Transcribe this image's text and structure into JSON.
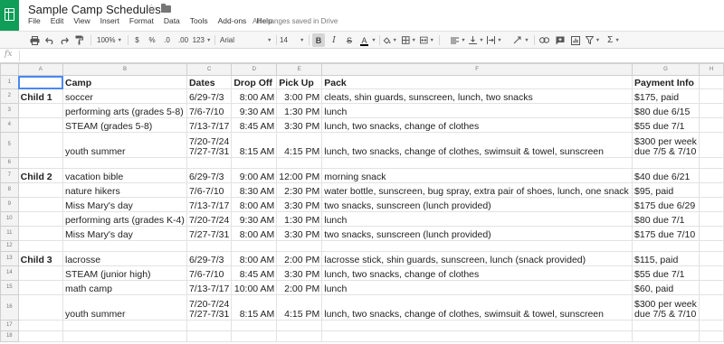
{
  "app": {
    "title": "Sample Camp Schedules",
    "save_status": "All changes saved in Drive",
    "icons": {
      "logo": "sheets-logo-icon",
      "star": "star-icon",
      "folder": "folder-icon"
    }
  },
  "menu": [
    "File",
    "Edit",
    "View",
    "Insert",
    "Format",
    "Data",
    "Tools",
    "Add-ons",
    "Help"
  ],
  "toolbar": {
    "zoom": "100%",
    "currency": "$",
    "percent": "%",
    "decrease_decimals": ".0",
    "increase_decimals": ".00",
    "more_formats": "123",
    "font": "Arial",
    "font_size": "14",
    "bold": "B",
    "italic": "I",
    "strikethrough": "S",
    "text_color": "A",
    "sum": "Σ",
    "icons": [
      "print-icon",
      "undo-icon",
      "redo-icon",
      "paint-format-icon",
      "fill-color-icon",
      "borders-icon",
      "merge-cells-icon",
      "horizontal-align-icon",
      "vertical-align-icon",
      "text-wrap-icon",
      "text-rotation-icon",
      "insert-link-icon",
      "insert-comment-icon",
      "insert-chart-icon",
      "filter-icon",
      "functions-icon"
    ]
  },
  "formula_bar": {
    "fx_label": "fx",
    "value": ""
  },
  "columns": [
    "A",
    "B",
    "C",
    "D",
    "E",
    "F",
    "G",
    "H"
  ],
  "rows": [
    {
      "num": "1",
      "type": "header",
      "cells": [
        "",
        "Camp",
        "Dates",
        "Drop Off",
        "Pick Up",
        "Pack",
        "Payment Info",
        ""
      ]
    },
    {
      "num": "2",
      "cells": [
        "Child 1",
        "soccer",
        "6/29-7/3",
        "8:00 AM",
        "3:00 PM",
        "cleats, shin guards, sunscreen, lunch, two snacks",
        "$175, paid",
        ""
      ]
    },
    {
      "num": "3",
      "cells": [
        "",
        "performing arts (grades 5-8)",
        "7/6-7/10",
        "9:30 AM",
        "1:30 PM",
        "lunch",
        "$80 due 6/15",
        ""
      ]
    },
    {
      "num": "4",
      "cells": [
        "",
        "STEAM (grades 5-8)",
        "7/13-7/17",
        "8:45 AM",
        "3:30 PM",
        "lunch, two snacks, change of clothes",
        "$55 due 7/1",
        ""
      ]
    },
    {
      "num": "5",
      "type": "tall",
      "cells": [
        "",
        "youth summer",
        "7/20-7/24\n7/27-7/31",
        "8:15 AM",
        "4:15 PM",
        "lunch, two snacks, change of clothes, swimsuit & towel, sunscreen",
        "$300 per week\ndue 7/5 & 7/10",
        ""
      ]
    },
    {
      "num": "6",
      "type": "gap",
      "cells": [
        "",
        "",
        "",
        "",
        "",
        "",
        "",
        ""
      ]
    },
    {
      "num": "7",
      "cells": [
        "Child 2",
        "vacation bible",
        "6/29-7/3",
        "9:00 AM",
        "12:00 PM",
        "morning snack",
        "$40 due 6/21",
        ""
      ]
    },
    {
      "num": "8",
      "cells": [
        "",
        "nature hikers",
        "7/6-7/10",
        "8:30 AM",
        "2:30 PM",
        "water bottle, sunscreen, bug spray, extra pair of shoes, lunch, one snack",
        "$95, paid",
        ""
      ]
    },
    {
      "num": "9",
      "cells": [
        "",
        "Miss Mary's day",
        "7/13-7/17",
        "8:00 AM",
        "3:30 PM",
        "two snacks, sunscreen (lunch provided)",
        "$175 due 6/29",
        ""
      ]
    },
    {
      "num": "10",
      "cells": [
        "",
        "performing arts (grades K-4)",
        "7/20-7/24",
        "9:30 AM",
        "1:30 PM",
        "lunch",
        "$80 due 7/1",
        ""
      ]
    },
    {
      "num": "11",
      "cells": [
        "",
        "Miss Mary's day",
        "7/27-7/31",
        "8:00 AM",
        "3:30 PM",
        "two snacks, sunscreen (lunch provided)",
        "$175 due 7/10",
        ""
      ]
    },
    {
      "num": "12",
      "type": "gap",
      "cells": [
        "",
        "",
        "",
        "",
        "",
        "",
        "",
        ""
      ]
    },
    {
      "num": "13",
      "cells": [
        "Child 3",
        "lacrosse",
        "6/29-7/3",
        "8:00 AM",
        "2:00 PM",
        "lacrosse stick, shin guards, sunscreen, lunch (snack provided)",
        "$115, paid",
        ""
      ]
    },
    {
      "num": "14",
      "cells": [
        "",
        "STEAM (junior high)",
        "7/6-7/10",
        "8:45 AM",
        "3:30 PM",
        "lunch, two snacks, change of clothes",
        "$55 due 7/1",
        ""
      ]
    },
    {
      "num": "15",
      "cells": [
        "",
        "math camp",
        "7/13-7/17",
        "10:00 AM",
        "2:00 PM",
        "lunch",
        "$60, paid",
        ""
      ]
    },
    {
      "num": "16",
      "type": "tall",
      "cells": [
        "",
        "youth summer",
        "7/20-7/24\n7/27-7/31",
        "8:15 AM",
        "4:15 PM",
        "lunch, two snacks, change of clothes, swimsuit & towel, sunscreen",
        "$300 per week\ndue 7/5 & 7/10",
        ""
      ]
    },
    {
      "num": "17",
      "type": "gap",
      "cells": [
        "",
        "",
        "",
        "",
        "",
        "",
        "",
        ""
      ]
    },
    {
      "num": "18",
      "type": "gap",
      "cells": [
        "",
        "",
        "",
        "",
        "",
        "",
        "",
        ""
      ]
    }
  ]
}
